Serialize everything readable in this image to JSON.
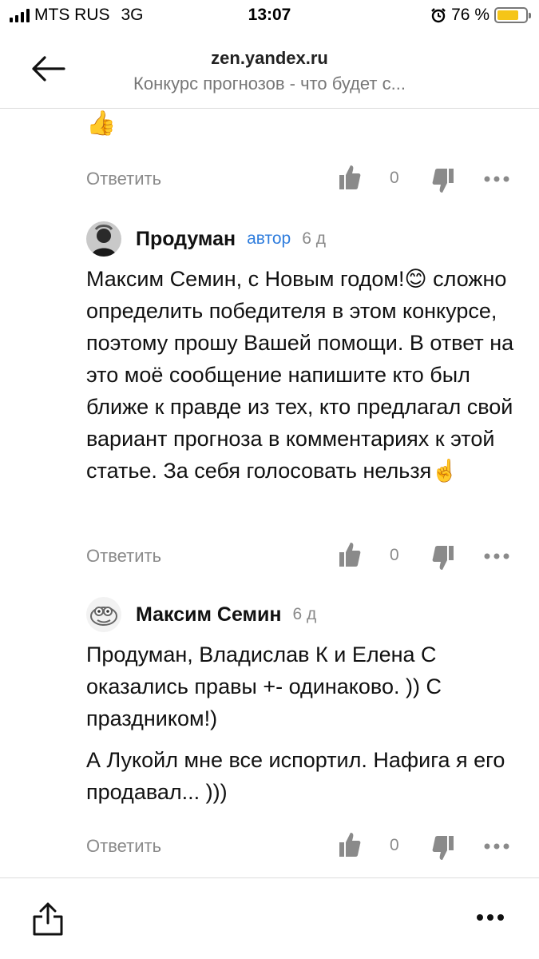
{
  "status": {
    "carrier": "MTS RUS",
    "network": "3G",
    "time": "13:07",
    "battery": "76 %"
  },
  "nav": {
    "domain": "zen.yandex.ru",
    "title": "Конкурс прогнозов - что будет с..."
  },
  "comments": [
    {
      "actions": {
        "reply": "Ответить",
        "count": "0"
      }
    },
    {
      "author": "Продуман",
      "tag": "автор",
      "date": "6 д",
      "text": "Максим Семин, с Новым годом!😊 сложно определить победителя в этом конкурсе, поэтому прошу Вашей помощи. В ответ на это моё сообщение напишите кто был ближе к правде из тех, кто предлагал свой вариант прогноза в комментариях к этой статье. За себя голосовать нельзя☝️",
      "actions": {
        "reply": "Ответить",
        "count": "0"
      }
    },
    {
      "author": "Максим Семин",
      "date": "6 д",
      "paragraphs": [
        "Продуман, Владислав К и Елена С оказались правы +- одинаково. )) С праздником!)",
        "А Лукойл мне все испортил. Нафига я его продавал... )))"
      ],
      "actions": {
        "reply": "Ответить",
        "count": "0"
      }
    }
  ],
  "colors": {
    "accent": "#2f7ddd",
    "muted": "#8a8a8a",
    "battery": "#f5c518"
  }
}
